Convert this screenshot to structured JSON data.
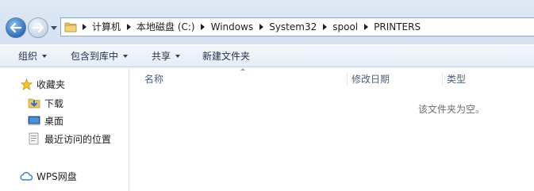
{
  "address_bar": {
    "breadcrumbs": [
      "计算机",
      "本地磁盘 (C:)",
      "Windows",
      "System32",
      "spool",
      "PRINTERS"
    ]
  },
  "toolbar": {
    "organize_label": "组织",
    "include_library_label": "包含到库中",
    "share_label": "共享",
    "new_folder_label": "新建文件夹"
  },
  "nav_pane": {
    "favorites_label": "收藏夹",
    "downloads_label": "下载",
    "desktop_label": "桌面",
    "recent_label": "最近访问的位置",
    "wps_label": "WPS网盘"
  },
  "file_list": {
    "columns": [
      "名称",
      "修改日期",
      "类型"
    ],
    "empty_message": "该文件夹为空。"
  },
  "colors": {
    "chrome_bg": "#dfe9f5",
    "accent_blue": "#2f6fb5",
    "empty_text": "#6d6d6d"
  }
}
